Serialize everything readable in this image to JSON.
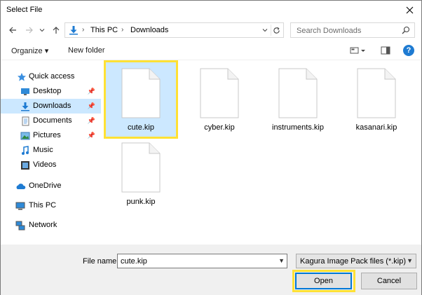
{
  "window": {
    "title": "Select File"
  },
  "nav": {
    "breadcrumbs": [
      "This PC",
      "Downloads"
    ],
    "search_placeholder": "Search Downloads"
  },
  "toolbar": {
    "organize_label": "Organize ▾",
    "new_folder_label": "New folder"
  },
  "sidebar": {
    "items": [
      {
        "label": "Quick access",
        "icon": "star-icon"
      },
      {
        "label": "Desktop",
        "icon": "desktop-icon"
      },
      {
        "label": "Downloads",
        "icon": "download-icon"
      },
      {
        "label": "Documents",
        "icon": "documents-icon"
      },
      {
        "label": "Pictures",
        "icon": "pictures-icon"
      },
      {
        "label": "Music",
        "icon": "music-icon"
      },
      {
        "label": "Videos",
        "icon": "videos-icon"
      },
      {
        "label": "OneDrive",
        "icon": "cloud-icon"
      },
      {
        "label": "This PC",
        "icon": "computer-icon"
      },
      {
        "label": "Network",
        "icon": "network-icon"
      }
    ]
  },
  "files": [
    {
      "name": "cute.kip"
    },
    {
      "name": "cyber.kip"
    },
    {
      "name": "instruments.kip"
    },
    {
      "name": "kasanari.kip"
    },
    {
      "name": "punk.kip"
    }
  ],
  "footer": {
    "filename_label": "File name:",
    "filename_value": "cute.kip",
    "filetype_value": "Kagura Image Pack files (*.kip)",
    "open_label": "Open",
    "cancel_label": "Cancel"
  },
  "colors": {
    "selection": "#cce8ff",
    "highlight": "#ffe135",
    "accent": "#0078d7"
  }
}
